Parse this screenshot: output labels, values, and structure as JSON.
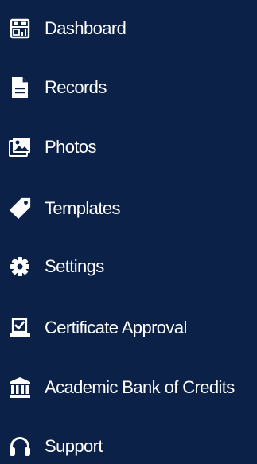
{
  "sidebar": {
    "items": [
      {
        "label": "Dashboard",
        "icon": "dashboard-icon"
      },
      {
        "label": "Records",
        "icon": "document-icon"
      },
      {
        "label": "Photos",
        "icon": "image-icon"
      },
      {
        "label": "Templates",
        "icon": "tag-icon"
      },
      {
        "label": "Settings",
        "icon": "gear-icon"
      },
      {
        "label": "Certificate Approval",
        "icon": "approval-checkbox-icon"
      },
      {
        "label": "Academic Bank of Credits",
        "icon": "bank-icon"
      },
      {
        "label": "Support",
        "icon": "headset-icon"
      }
    ]
  },
  "colors": {
    "background": "#0c2147",
    "text": "#ffffff",
    "icon": "#ffffff"
  }
}
